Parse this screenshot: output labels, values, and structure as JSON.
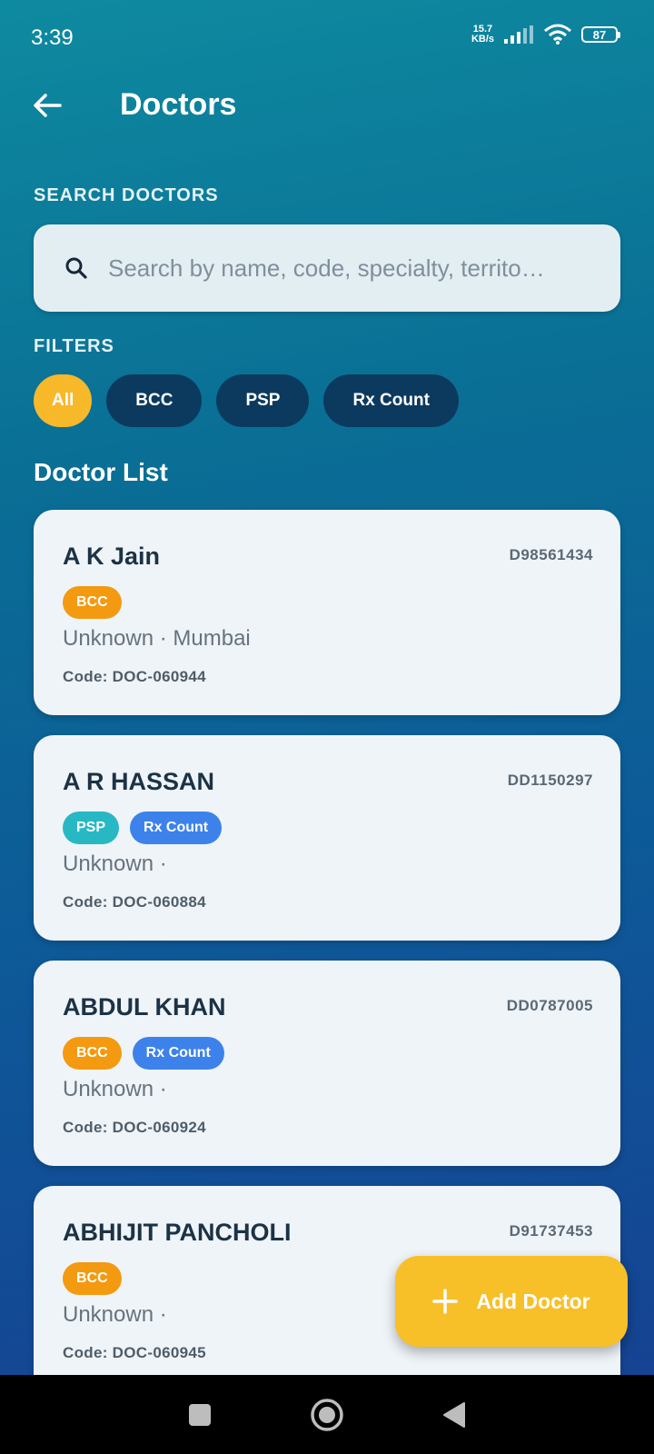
{
  "status_bar": {
    "time": "3:39",
    "net_speed_value": "15.7",
    "net_speed_unit": "KB/s",
    "battery": "87",
    "icons": [
      "signal-icon",
      "wifi-icon",
      "battery-icon"
    ]
  },
  "header": {
    "title": "Doctors",
    "back_icon": "arrow-left-icon"
  },
  "search": {
    "section_label": "SEARCH DOCTORS",
    "placeholder": "Search by name, code, specialty, territo…",
    "value": "",
    "icon": "search-icon"
  },
  "filters": {
    "section_label": "FILTERS",
    "chips": [
      {
        "label": "All",
        "active": true
      },
      {
        "label": "BCC",
        "active": false
      },
      {
        "label": "PSP",
        "active": false
      },
      {
        "label": "Rx Count",
        "active": false
      }
    ]
  },
  "list": {
    "title": "Doctor List",
    "doctors": [
      {
        "name": "A K Jain",
        "id": "D98561434",
        "tags": [
          {
            "label": "BCC",
            "color": "#f39a11"
          }
        ],
        "meta": "Unknown · Mumbai",
        "code": "Code: DOC-060944"
      },
      {
        "name": "A R HASSAN",
        "id": "DD1150297",
        "tags": [
          {
            "label": "PSP",
            "color": "#27b8c4"
          },
          {
            "label": "Rx Count",
            "color": "#3d82ea"
          }
        ],
        "meta": "Unknown ·",
        "code": "Code: DOC-060884"
      },
      {
        "name": "ABDUL KHAN",
        "id": "DD0787005",
        "tags": [
          {
            "label": "BCC",
            "color": "#f39a11"
          },
          {
            "label": "Rx Count",
            "color": "#3d82ea"
          }
        ],
        "meta": "Unknown ·",
        "code": "Code: DOC-060924"
      },
      {
        "name": "ABHIJIT PANCHOLI",
        "id": "D91737453",
        "tags": [
          {
            "label": "BCC",
            "color": "#f39a11"
          }
        ],
        "meta": "Unknown ·",
        "code": "Code: DOC-060945"
      }
    ]
  },
  "fab": {
    "label": "Add Doctor",
    "icon": "plus-icon",
    "color": "#f7c028"
  },
  "nav_bar": {
    "icons": [
      "recents-square-icon",
      "home-circle-icon",
      "back-triangle-icon"
    ]
  },
  "colors": {
    "accent": "#f7b82a",
    "chip_default": "#0c3a5e",
    "card_bg": "#eff4f8"
  }
}
